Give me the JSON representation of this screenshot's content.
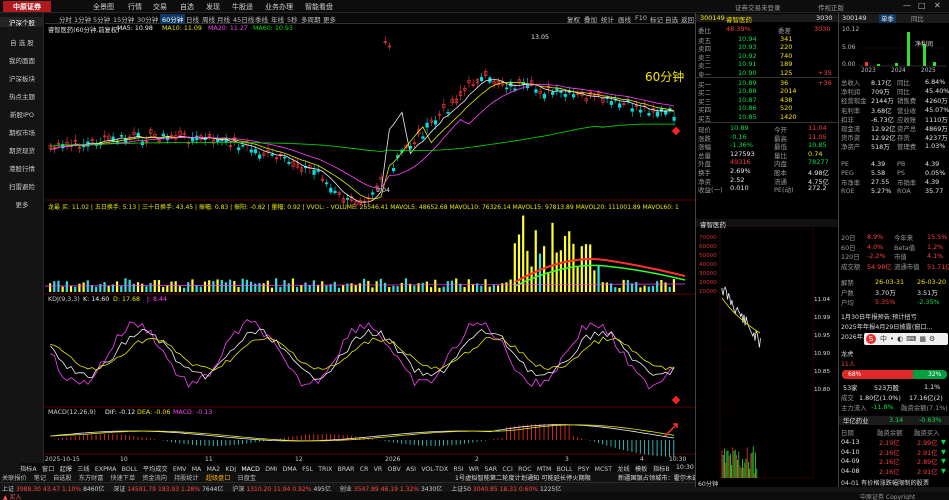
{
  "app": {
    "logo_text": "中原证券",
    "menu": [
      "全景图",
      "行情",
      "交易",
      "自选",
      "发现",
      "牛股遥",
      "业务办理",
      "智能看盘"
    ],
    "top_right_text": "证券交易未登录",
    "top_right_extra": "传视正版",
    "window_controls": [
      "—",
      "□",
      "✕"
    ]
  },
  "sidebar": {
    "items": [
      "沪深个股",
      "自 选 股",
      "我的面面",
      "沪深板块",
      "热点主题",
      "新股IPO",
      "期权市场",
      "期货现货",
      "港股行情",
      "扫雷避险",
      "更多"
    ],
    "active_index": 0
  },
  "toolbar": {
    "periods": [
      "分时",
      "1分钟",
      "5分钟",
      "15分钟",
      "30分钟",
      "60分钟",
      "日线",
      "周线",
      "月线",
      "45日线",
      "季线",
      "年线",
      "5秒",
      "多周期",
      "更多"
    ],
    "active_period_index": 5,
    "right_tools": [
      "复权",
      "叠加",
      "统计",
      "画线",
      "F10",
      "标记",
      "自选",
      "返回"
    ]
  },
  "chart": {
    "stock_header": "睿智医药(60分钟,前复权)",
    "ma_legend": [
      {
        "text": "MA5: 10.98",
        "color": "#f0f0f0"
      },
      {
        "text": "MA10: 11.09",
        "color": "#e8e800"
      },
      {
        "text": "MA20: 11.27",
        "color": "#ff40ff"
      },
      {
        "text": "MA60: 10.93",
        "color": "#00e000"
      }
    ],
    "period_label": "60分钟",
    "high_label": "13.05",
    "low_label": "9.04",
    "vol_legend": "龙最 买: 11.02 | 五日换手: 5.13 | 三十日换手: 43.45 | 振幅: 0.83 | 振阳: -0.82 | 量幅: 0.92 | VVOL: - VOLUME: 25546.41  MAVOL5: 48652.68  MAVOL10: 76326.14  MAVOL15: 97813.89  MAVOL20: 111001.89  MAVOL60: 1",
    "kdj_legend": [
      {
        "text": "KDJ(9,3,3)",
        "color": "#d0d0d0"
      },
      {
        "text": "K: 14.60",
        "color": "#f0f0f0"
      },
      {
        "text": "D: 17.68",
        "color": "#e8e800"
      },
      {
        "text": "J: 8.44",
        "color": "#ff40ff"
      }
    ],
    "macd_legend": [
      {
        "text": "MACD(12,26,9)",
        "color": "#d0d0d0"
      },
      {
        "text": "DIF: -0.12",
        "color": "#f0f0f0"
      },
      {
        "text": "DEA: -0.06",
        "color": "#e8e800"
      },
      {
        "text": "MACD: -0.13",
        "color": "#ff40ff"
      }
    ],
    "axis_labels": [
      "2025-10-15",
      "10",
      "11",
      "12",
      "2026",
      "2",
      "3",
      "4"
    ],
    "timestamp": "10:30"
  },
  "indicator_bar": {
    "items": [
      "指标A",
      "窗口",
      "起爆",
      "三线",
      "EXPMA",
      "BOLL",
      "平均成交",
      "EMV",
      "MA",
      "MA2",
      "KDJ",
      "MACD",
      "DMI",
      "DMA",
      "FSL",
      "TRIX",
      "BRAR",
      "CR",
      "VR",
      "OBV",
      "ASI",
      "VOL-TDX",
      "RSI",
      "WR",
      "SAR",
      "CCI",
      "ROC",
      "MTM",
      "BOLL",
      "PSY",
      "MCST",
      "龙线",
      "模板"
    ],
    "right_text": "指标B",
    "right_time": "10:30"
  },
  "tab_bar": {
    "items": [
      "关联报价",
      "笔记",
      "自选股",
      "东方财富",
      "快速下单",
      "资金流向",
      "持股统计",
      "超级盘口",
      "日盘宝"
    ],
    "news": "1号虚拟智能第二轮度计划通知 可能延长停火期限",
    "news2": "新疆国银占领城市：霍尔木兹海峡可能重设无人区驻军"
  },
  "status_bar": {
    "items": [
      {
        "label": "上证",
        "value": "3988.30",
        "change": "43.47",
        "pct": "1.10%",
        "amount": "8460亿"
      },
      {
        "label": "深证",
        "value": "14591.79",
        "change": "183.93",
        "pct": "1.28%",
        "amount": "7644亿"
      },
      {
        "label": "沪深",
        "value": "1310.20",
        "change": "11.94",
        "pct": "0.92%",
        "amount": "495亿"
      },
      {
        "label": "创业",
        "value": "3547.89",
        "change": "46.19",
        "pct": "1.32%",
        "amount": "3430亿"
      },
      {
        "label": "上证50",
        "value": "3040.85",
        "change": "18.31",
        "pct": "0.60%",
        "amount": "1225亿"
      }
    ]
  },
  "bottom_strip": {
    "left": "▲ 买入",
    "right": "中原证券 Copyright"
  },
  "quote": {
    "code": "300149",
    "name": "睿智医药",
    "header_right": "3030",
    "weibi_label": "委比",
    "weibi": "48.39%",
    "weicha_label": "委差",
    "weicha": "3030",
    "asks": [
      {
        "label": "卖五",
        "price": "10.94",
        "vol": "341"
      },
      {
        "label": "卖四",
        "price": "10.93",
        "vol": "220"
      },
      {
        "label": "卖三",
        "price": "10.92",
        "vol": "740"
      },
      {
        "label": "卖二",
        "price": "10.91",
        "vol": "189"
      },
      {
        "label": "卖一",
        "price": "10.90",
        "vol": "125",
        "change": "+35"
      }
    ],
    "bids": [
      {
        "label": "买一",
        "price": "10.89",
        "vol": "36",
        "change": "+36"
      },
      {
        "label": "买二",
        "price": "10.88",
        "vol": "2014"
      },
      {
        "label": "买三",
        "price": "10.87",
        "vol": "438"
      },
      {
        "label": "买四",
        "price": "10.86",
        "vol": "520"
      },
      {
        "label": "买五",
        "price": "10.85",
        "vol": "1420"
      }
    ],
    "stats": [
      {
        "l1": "现价",
        "v1": "10.89",
        "l2": "今开",
        "v2": "11.04",
        "c1": "green",
        "c2": "red"
      },
      {
        "l1": "涨跌",
        "v1": "-0.16",
        "l2": "最高",
        "v2": "11.05",
        "c1": "green",
        "c2": "red"
      },
      {
        "l1": "涨幅",
        "v1": "-1.36%",
        "l2": "最低",
        "v2": "10.85",
        "c1": "green",
        "c2": "green"
      },
      {
        "l1": "总量",
        "v1": "127593",
        "l2": "量比",
        "v2": "0.74",
        "c1": "white",
        "c2": "yellow"
      },
      {
        "l1": "外盘",
        "v1": "49316",
        "l2": "内盘",
        "v2": "78277",
        "c1": "red",
        "c2": "green"
      },
      {
        "l1": "换手",
        "v1": "2.69%",
        "l2": "股本",
        "v2": "4.98亿",
        "c1": "white",
        "c2": "white"
      },
      {
        "l1": "净资",
        "v1": "2.52",
        "l2": "流通",
        "v2": "4.75亿",
        "c1": "white",
        "c2": "white"
      },
      {
        "l1": "收益(一)",
        "v1": "0.010",
        "l2": "PE(动)",
        "v2": "272.2",
        "c1": "white",
        "c2": "white"
      }
    ],
    "mini_title": "睿智医药",
    "mini_yticks": [
      "70000",
      "60000",
      "50000",
      "40000",
      "30000",
      "20000",
      "10000"
    ],
    "mini_price_ticks": [
      "11.04",
      "10.99",
      "10.95",
      "10.90",
      "10.85",
      "10.80"
    ],
    "mini_label": "60分钟"
  },
  "fund": {
    "code": "300149",
    "tabs": [
      "单季",
      "同比"
    ],
    "chart_values": [
      "10.12",
      "5.06",
      "0.00"
    ],
    "chart_label_right": "净利润",
    "years": [
      "2023",
      "2024",
      "2025"
    ],
    "rows": [
      {
        "l": "总收入",
        "v": "8.17亿",
        "l2": "同比",
        "v2": "6.84%"
      },
      {
        "l": "净利润",
        "v": "709万",
        "l2": "同比",
        "v2": "45.40%"
      },
      {
        "l": "经营现金",
        "v": "2144万",
        "l2": "销售费",
        "v2": "4260万"
      },
      {
        "l": "毛利率",
        "v": "3.68亿",
        "l2": "营业收",
        "v2": "45.07%"
      },
      {
        "l": "扣非",
        "v": "-6.73亿",
        "l2": "应收账",
        "v2": "1110万"
      },
      {
        "l": "现金流",
        "v": "12.92亿",
        "l2": "资产总",
        "v2": "4869万"
      },
      {
        "l": "货币资",
        "v": "12.92亿",
        "l2": "存货",
        "v2": "4237万"
      },
      {
        "l": "净资产",
        "v": "518万",
        "l2": "管理费",
        "v2": "1.03%"
      },
      {
        "l": "PE",
        "v": "4.39",
        "l2": "PB",
        "v2": "4.39"
      },
      {
        "l": "PEG",
        "v": "5.58",
        "l2": "PS",
        "v2": "0.05%"
      },
      {
        "l": "市净率",
        "v": "27.55",
        "l2": "市销率",
        "v2": "4.39"
      },
      {
        "l": "ROE",
        "v": "5.27%",
        "l2": "ROA",
        "v2": "35.77"
      }
    ],
    "row2": [
      {
        "l": "20日",
        "v": "8.9%",
        "l2": "今年来",
        "v2": "15.5%"
      },
      {
        "l": "60日",
        "v": "4.0%",
        "l2": "Beta值",
        "v2": "1.2%"
      },
      {
        "l": "120日",
        "v": "-2.2%",
        "l2": "市值",
        "v2": "4.1%"
      },
      {
        "l": "成交额",
        "v": "54.98亿",
        "l2": "流通市值",
        "v2": "51.71亿"
      }
    ],
    "event": {
      "l": "解禁",
      "v": "26-03-31",
      "v2": "26-03-20"
    },
    "share": {
      "l": "户数",
      "v": "3.70万",
      "v2": "3.51万"
    },
    "share2": {
      "l": "户均",
      "v": "5.35%",
      "v2": "-2.35%"
    },
    "notice1": "1月30日年报预告:预计扭亏",
    "notice2": "2025年年报4月29日披露(窗口...",
    "notice3": "2026年...",
    "shares_label": "龙虎",
    "shares_num": "11人",
    "ratio_buy": "68%",
    "ratio_sell": "32%",
    "board_a": "53家",
    "board_b": "523万股",
    "board_c": "1.1%",
    "turnover_label": "成交",
    "turnover_v": "1.80亿(1.0%)",
    "turnover_r": "17.16亿(2)",
    "zjlx_label": "主力流入",
    "zjlx_v": "-11.8%",
    "zjlx_r": "融资余额(7.1%)",
    "sector_name": "华亿药业",
    "sector_price": "3.14",
    "sector_pct": "-0.63%",
    "date_hdr": [
      "日期",
      "融资余额",
      "融资买入"
    ],
    "date_rows": [
      {
        "d": "04-13",
        "a": "2.19亿",
        "b": "2.99亿"
      },
      {
        "d": "04-10",
        "a": "2.16亿",
        "b": "2.91亿"
      },
      {
        "d": "04-09",
        "a": "2.16亿",
        "b": "2.89亿"
      },
      {
        "d": "04-08",
        "a": "2.16亿",
        "b": "2.91亿"
      }
    ],
    "last_row": "04-01 有价格涨跌幅限制的股票"
  },
  "colors": {
    "up": "#ff3d3d",
    "down": "#00e0e0",
    "ma5": "#f0f0f0",
    "ma10": "#e8e800",
    "ma20": "#ff40ff",
    "ma60": "#00e000",
    "accent": "#b0191d"
  }
}
